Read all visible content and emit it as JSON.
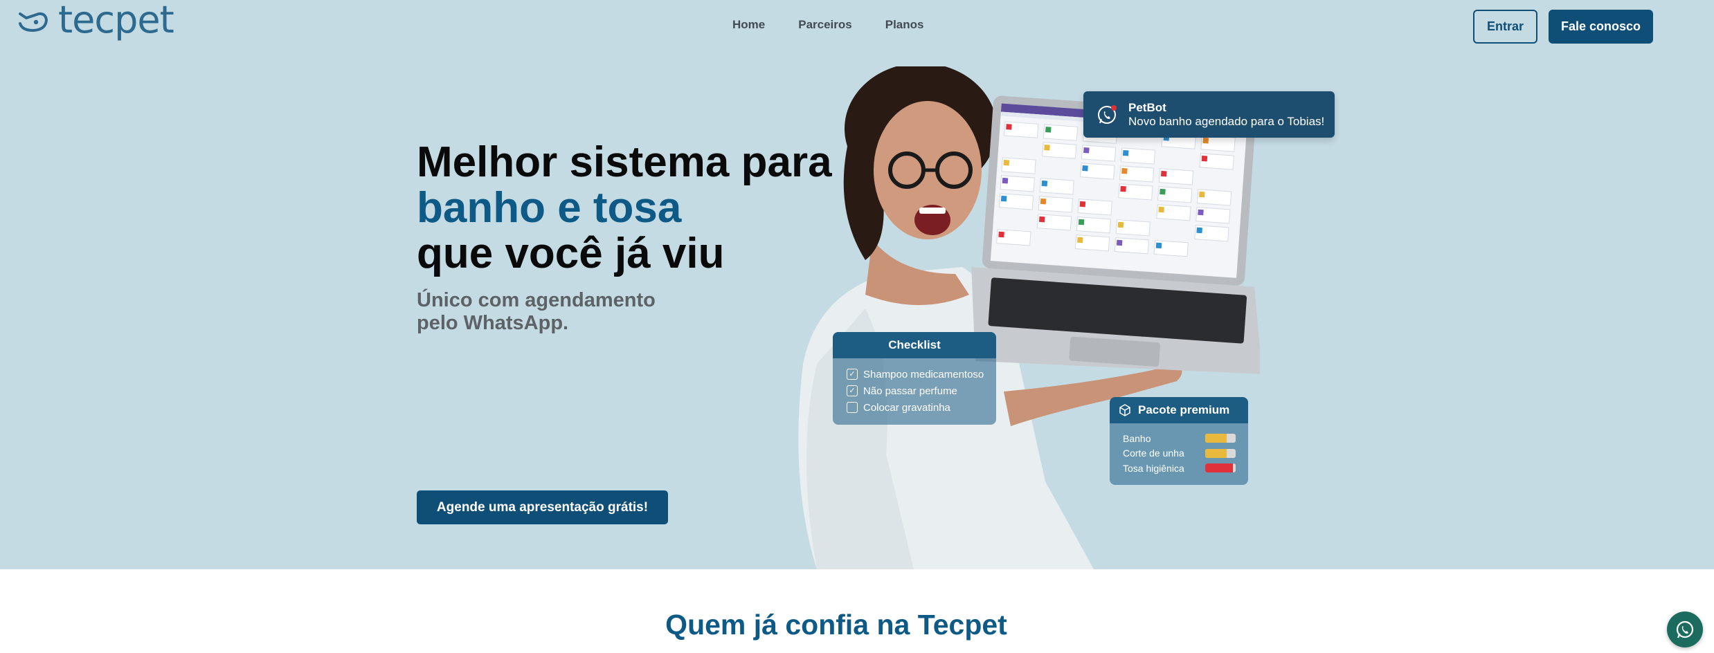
{
  "brand": {
    "name": "tecpet"
  },
  "nav": {
    "items": [
      "Home",
      "Parceiros",
      "Planos"
    ]
  },
  "header": {
    "login_label": "Entrar",
    "contact_label": "Fale conosco"
  },
  "hero": {
    "headline_line1": "Melhor sistema para",
    "headline_accent": "banho e tosa",
    "headline_line3": "que você já viu",
    "subline_line1": "Único com agendamento",
    "subline_line2": "pelo WhatsApp.",
    "cta_label": "Agende uma apresentação grátis!"
  },
  "notification": {
    "title": "PetBot",
    "message": "Novo banho agendado para o Tobias!"
  },
  "checklist": {
    "title": "Checklist",
    "items": [
      {
        "label": "Shampoo medicamentoso",
        "checked": true
      },
      {
        "label": "Não passar perfume",
        "checked": true
      },
      {
        "label": "Colocar gravatinha",
        "checked": false
      }
    ]
  },
  "package": {
    "title": "Pacote premium",
    "items": [
      {
        "label": "Banho",
        "progress": 0.7,
        "color": "#e8b93c"
      },
      {
        "label": "Corte de unha",
        "progress": 0.7,
        "color": "#e8b93c"
      },
      {
        "label": "Tosa higiênica",
        "progress": 0.9,
        "color": "#e0313a"
      }
    ]
  },
  "section": {
    "title": "Quem já confia na Tecpet"
  },
  "colors": {
    "hero_bg": "#c5dbe4",
    "primary": "#0e4e77",
    "accent": "#0e5a86"
  }
}
